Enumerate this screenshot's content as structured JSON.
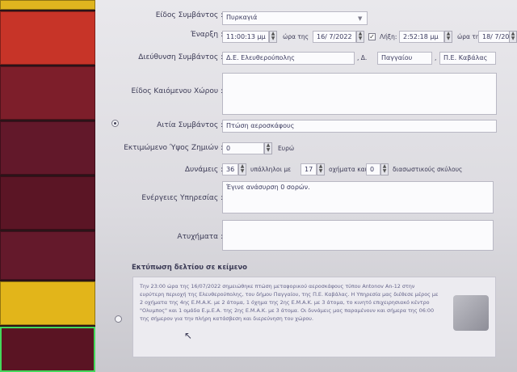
{
  "form": {
    "incident_type": {
      "label": "Είδος Συμβάντος :",
      "value": "Πυρκαγιά"
    },
    "start": {
      "label": "Έναρξη :",
      "time": "11:00:13 μμ",
      "time_label": "ώρα της",
      "date": "16/ 7/2022",
      "end_label": "Λήξη:",
      "end_time": "2:52:18 μμ",
      "end_date_label": "ώρα της",
      "end_date": "18/ 7/2022"
    },
    "address": {
      "label": "Διεύθυνση Συμβάντος :",
      "street": "Δ.Ε. Ελευθερούπολης",
      "municipality_prefix": ", Δ.",
      "municipality": "Παγγαίου",
      "unit_prefix": ",",
      "unit": "Π.Ε. Καβάλας"
    },
    "burned_area_type": {
      "label": "Είδος Καιόμενου Χώρου :",
      "value": ""
    },
    "cause": {
      "label": "Αιτία Συμβάντος :",
      "value": "Πτώση αεροσκάφους"
    },
    "damage": {
      "label": "Εκτιμώμενο Ύψος Ζημιών :",
      "value": "0",
      "unit": "Ευρώ"
    },
    "forces": {
      "label": "Δυνάμεις :",
      "personnel": "36",
      "personnel_label": "υπάλληλοι με",
      "vehicles": "17",
      "vehicles_label": "οχήματα και",
      "aircraft": "0",
      "aircraft_label": "διασωστικούς σκύλους"
    },
    "actions": {
      "label": "Ενέργειες Υπηρεσίας :",
      "value": "Έγινε ανάσυρση 0 σορών."
    },
    "accidents": {
      "label": "Ατυχήματα :",
      "value": ""
    }
  },
  "report": {
    "title": "Εκτύπωση δελτίου σε κείμενο",
    "text": "Την 23:00 ώρα της 16/07/2022 σημειώθηκε πτώση μεταφορικού αεροσκάφους τύπου Antonov An-12 στην ευρύτερη περιοχή της Ελευθερούπολης, του δήμου Παγγαίου, της Π.Ε. Καβάλας. Η Υπηρεσία μας διέθεσε μέρος με 2 οχήματα της 4ης Ε.Μ.Α.Κ. με 2 άτομα, 1 όχημα της 2ης Ε.Μ.Α.Κ. με 3 άτομα, το κινητό επιχειρησιακό κέντρο \"Ολυμπος\" και 1 ομάδα Ε.μ.Ε.Α. της 2ης Ε.Μ.Α.Κ. με 3 άτομα. Οι δυνάμεις μας παραμένουν και σήμερα της 06:00 της σήμερον για την πλήρη κατάσβεση και διερεύνηση του χώρου."
  },
  "colors": {
    "panel": "#e4e3e8",
    "text": "#3b3a55",
    "sidebar": "#2a1418"
  }
}
